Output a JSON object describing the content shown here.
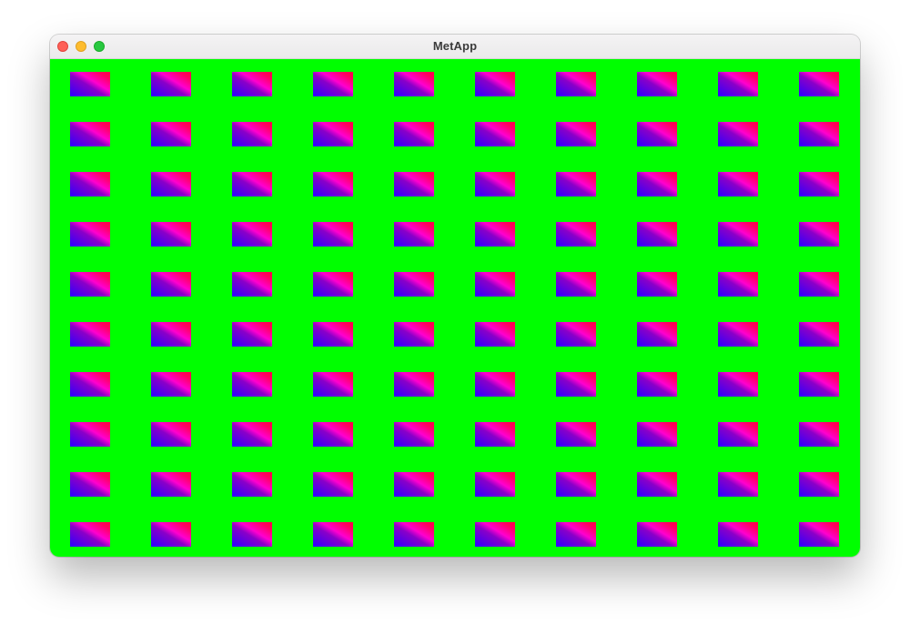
{
  "window": {
    "title": "MetApp",
    "controls": [
      {
        "name": "close",
        "color": "#fe5f57"
      },
      {
        "name": "minimize",
        "color": "#febc2e"
      },
      {
        "name": "zoom",
        "color": "#28c840"
      }
    ]
  },
  "canvas": {
    "background_color": "#00ff00",
    "tile_grid": {
      "rows": 10,
      "columns": 10,
      "tile_gradient": [
        "#2a00ff",
        "#8a00c8",
        "#ff00d0",
        "#ff0040"
      ]
    }
  }
}
